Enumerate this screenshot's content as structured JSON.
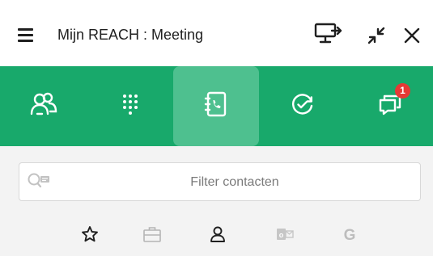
{
  "window": {
    "title": "Mijn REACH : Meeting"
  },
  "nav": {
    "items": [
      {
        "name": "contacts",
        "icon": "users-icon"
      },
      {
        "name": "dialpad",
        "icon": "dialpad-icon"
      },
      {
        "name": "phonebook",
        "icon": "phonebook-icon",
        "active": true
      },
      {
        "name": "history",
        "icon": "history-check-icon"
      },
      {
        "name": "messages",
        "icon": "chat-icon",
        "badge": "1"
      }
    ],
    "badge_count": "1"
  },
  "search": {
    "placeholder": "Filter contacten",
    "value": ""
  },
  "filters": {
    "items": [
      {
        "name": "favorites",
        "icon": "star-icon"
      },
      {
        "name": "work",
        "icon": "briefcase-icon"
      },
      {
        "name": "personal",
        "icon": "person-icon"
      },
      {
        "name": "outlook",
        "icon": "outlook-icon"
      },
      {
        "name": "google",
        "icon": "google-icon",
        "label": "G"
      }
    ]
  },
  "colors": {
    "brand_green": "#18a96b",
    "active_tab": "#4ec08f",
    "badge_red": "#e53935"
  }
}
